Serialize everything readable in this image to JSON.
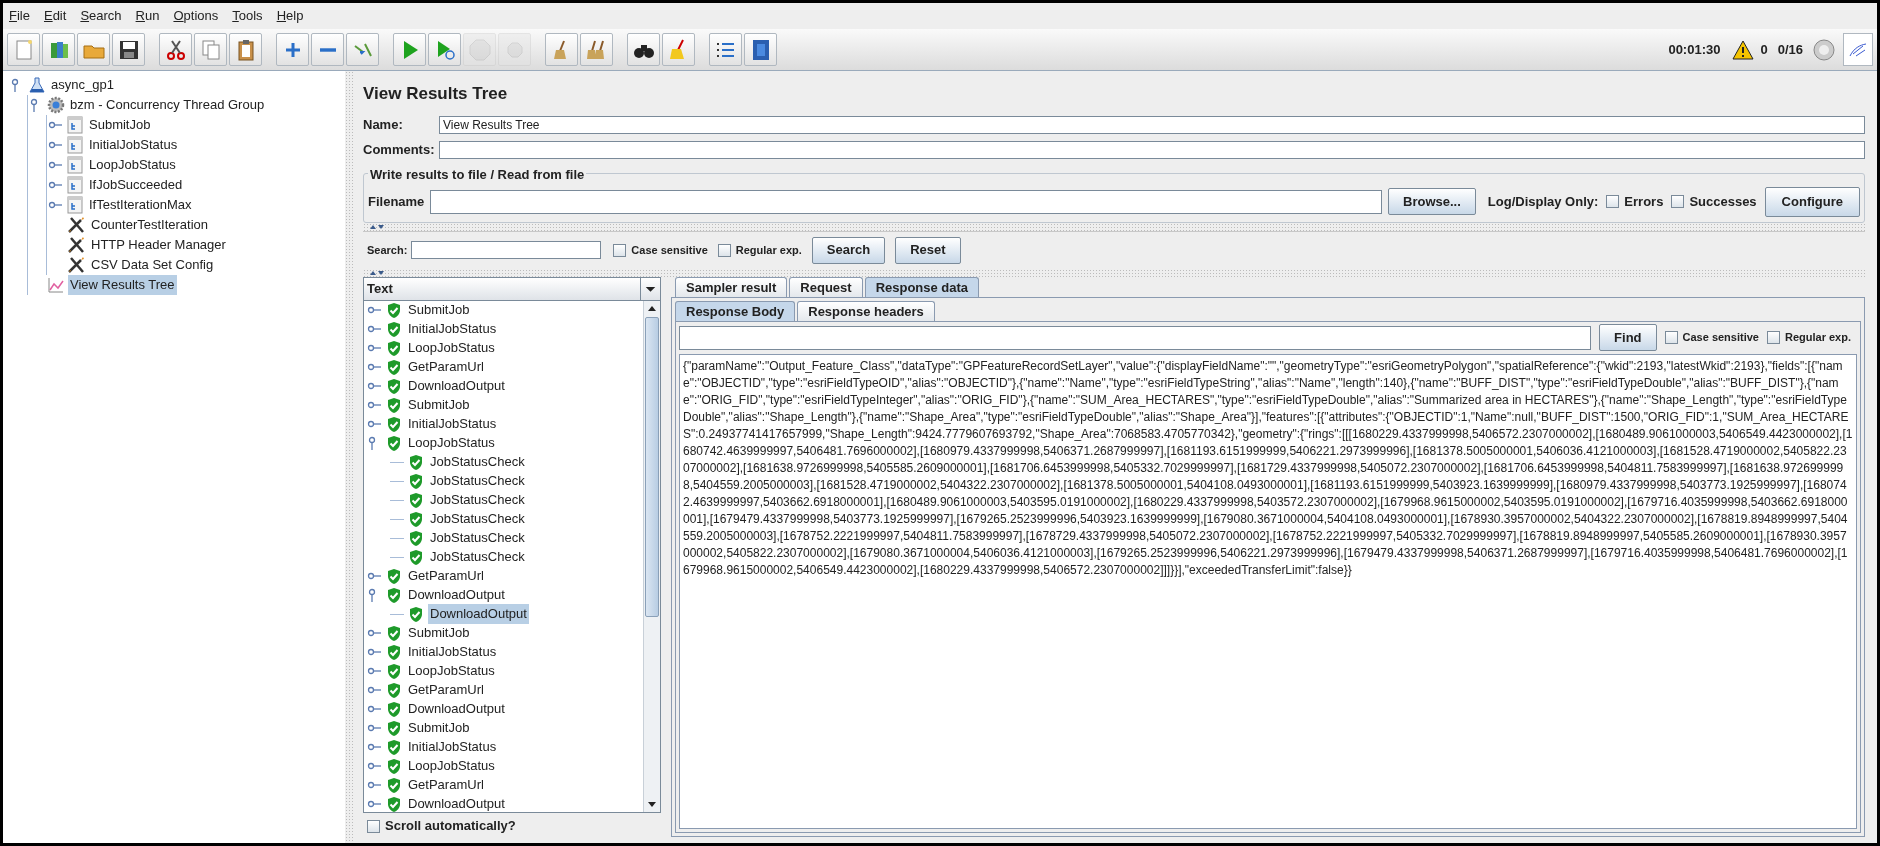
{
  "menu": [
    "File",
    "Edit",
    "Search",
    "Run",
    "Options",
    "Tools",
    "Help"
  ],
  "toolbar": [
    {
      "kind": "new",
      "disabled": false
    },
    {
      "kind": "templates",
      "disabled": false
    },
    {
      "kind": "open",
      "disabled": false
    },
    {
      "kind": "save",
      "disabled": false
    },
    {
      "kind": "separator"
    },
    {
      "kind": "cut",
      "disabled": false
    },
    {
      "kind": "copy",
      "disabled": false
    },
    {
      "kind": "paste",
      "disabled": false
    },
    {
      "kind": "separator"
    },
    {
      "kind": "expand",
      "disabled": false
    },
    {
      "kind": "collapse",
      "disabled": false
    },
    {
      "kind": "toggle",
      "disabled": false
    },
    {
      "kind": "separator"
    },
    {
      "kind": "start",
      "disabled": false
    },
    {
      "kind": "start_no_pauses",
      "disabled": false
    },
    {
      "kind": "stop",
      "disabled": true
    },
    {
      "kind": "shutdown",
      "disabled": true
    },
    {
      "kind": "separator"
    },
    {
      "kind": "clear",
      "disabled": false
    },
    {
      "kind": "clear_all",
      "disabled": false
    },
    {
      "kind": "separator"
    },
    {
      "kind": "search",
      "disabled": false
    },
    {
      "kind": "reset_search",
      "disabled": false
    },
    {
      "kind": "separator"
    },
    {
      "kind": "function_helper",
      "disabled": false
    },
    {
      "kind": "help",
      "disabled": false
    }
  ],
  "status": {
    "elapsed": "00:01:30",
    "warnings": "0",
    "threads": "0/16"
  },
  "test_plan": [
    {
      "label": "async_gp1",
      "kind": "plan",
      "expanded": true,
      "selected": false,
      "children": [
        {
          "label": "bzm - Concurrency Thread Group",
          "kind": "thread_group",
          "expanded": true,
          "selected": false,
          "children": [
            {
              "label": "SubmitJob",
              "kind": "controller",
              "expanded": false,
              "selected": false
            },
            {
              "label": "InitialJobStatus",
              "kind": "controller",
              "expanded": false,
              "selected": false
            },
            {
              "label": "LoopJobStatus",
              "kind": "controller",
              "expanded": false,
              "selected": false
            },
            {
              "label": "IfJobSucceeded",
              "kind": "controller",
              "expanded": false,
              "selected": false
            },
            {
              "label": "IfTestIterationMax",
              "kind": "controller",
              "expanded": false,
              "selected": false
            },
            {
              "label": "CounterTestIteration",
              "kind": "config",
              "selected": false
            },
            {
              "label": "HTTP Header Manager",
              "kind": "config",
              "selected": false
            },
            {
              "label": "CSV Data Set Config",
              "kind": "config",
              "selected": false
            }
          ]
        },
        {
          "label": "View Results Tree",
          "kind": "listener",
          "selected": true
        }
      ]
    }
  ],
  "panel": {
    "title": "View Results Tree",
    "name_label": "Name:",
    "name_value": "View Results Tree",
    "comments_label": "Comments:",
    "file_group": {
      "title": "Write results to file / Read from file",
      "filename_label": "Filename",
      "browse": "Browse...",
      "log_label": "Log/Display Only:",
      "errors": {
        "label": "Errors",
        "checked": false
      },
      "successes": {
        "label": "Successes",
        "checked": false
      },
      "configure": "Configure"
    },
    "search": {
      "label": "Search:",
      "case_sensitive": {
        "label": "Case sensitive",
        "checked": false
      },
      "regex": {
        "label": "Regular exp.",
        "checked": false
      },
      "search_button": "Search",
      "reset_button": "Reset"
    }
  },
  "results": {
    "header": "Text",
    "scroll_auto": {
      "label": "Scroll automatically?",
      "checked": false
    },
    "items": [
      {
        "label": "SubmitJob",
        "expanded": false,
        "selected": false
      },
      {
        "label": "InitialJobStatus",
        "expanded": false,
        "selected": false
      },
      {
        "label": "LoopJobStatus",
        "expanded": false,
        "selected": false
      },
      {
        "label": "GetParamUrl",
        "expanded": false,
        "selected": false
      },
      {
        "label": "DownloadOutput",
        "expanded": false,
        "selected": false
      },
      {
        "label": "SubmitJob",
        "expanded": false,
        "selected": false
      },
      {
        "label": "InitialJobStatus",
        "expanded": false,
        "selected": false
      },
      {
        "label": "LoopJobStatus",
        "expanded": true,
        "selected": false,
        "children": [
          {
            "label": "JobStatusCheck",
            "selected": false
          },
          {
            "label": "JobStatusCheck",
            "selected": false
          },
          {
            "label": "JobStatusCheck",
            "selected": false
          },
          {
            "label": "JobStatusCheck",
            "selected": false
          },
          {
            "label": "JobStatusCheck",
            "selected": false
          },
          {
            "label": "JobStatusCheck",
            "selected": false
          }
        ]
      },
      {
        "label": "GetParamUrl",
        "expanded": false,
        "selected": false
      },
      {
        "label": "DownloadOutput",
        "expanded": true,
        "selected": false,
        "children": [
          {
            "label": "DownloadOutput",
            "selected": true
          }
        ]
      },
      {
        "label": "SubmitJob",
        "expanded": false,
        "selected": false
      },
      {
        "label": "InitialJobStatus",
        "expanded": false,
        "selected": false
      },
      {
        "label": "LoopJobStatus",
        "expanded": false,
        "selected": false
      },
      {
        "label": "GetParamUrl",
        "expanded": false,
        "selected": false
      },
      {
        "label": "DownloadOutput",
        "expanded": false,
        "selected": false
      },
      {
        "label": "SubmitJob",
        "expanded": false,
        "selected": false
      },
      {
        "label": "InitialJobStatus",
        "expanded": false,
        "selected": false
      },
      {
        "label": "LoopJobStatus",
        "expanded": false,
        "selected": false
      },
      {
        "label": "GetParamUrl",
        "expanded": false,
        "selected": false
      },
      {
        "label": "DownloadOutput",
        "expanded": false,
        "selected": false
      }
    ]
  },
  "detail": {
    "tabs": [
      {
        "label": "Sampler result",
        "selected": false
      },
      {
        "label": "Request",
        "selected": false
      },
      {
        "label": "Response data",
        "selected": true
      }
    ],
    "subtabs": [
      {
        "label": "Response Body",
        "selected": true
      },
      {
        "label": "Response headers",
        "selected": false
      }
    ],
    "find_button": "Find",
    "case_sensitive": {
      "label": "Case sensitive",
      "checked": false
    },
    "regex": {
      "label": "Regular exp.",
      "checked": false
    },
    "response_text": "{\"paramName\":\"Output_Feature_Class\",\"dataType\":\"GPFeatureRecordSetLayer\",\"value\":{\"displayFieldName\":\"\",\"geometryType\":\"esriGeometryPolygon\",\"spatialReference\":{\"wkid\":2193,\"latestWkid\":2193},\"fields\":[{\"name\":\"OBJECTID\",\"type\":\"esriFieldTypeOID\",\"alias\":\"OBJECTID\"},{\"name\":\"Name\",\"type\":\"esriFieldTypeString\",\"alias\":\"Name\",\"length\":140},{\"name\":\"BUFF_DIST\",\"type\":\"esriFieldTypeDouble\",\"alias\":\"BUFF_DIST\"},{\"name\":\"ORIG_FID\",\"type\":\"esriFieldTypeInteger\",\"alias\":\"ORIG_FID\"},{\"name\":\"SUM_Area_HECTARES\",\"type\":\"esriFieldTypeDouble\",\"alias\":\"Summarized area in HECTARES\"},{\"name\":\"Shape_Length\",\"type\":\"esriFieldTypeDouble\",\"alias\":\"Shape_Length\"},{\"name\":\"Shape_Area\",\"type\":\"esriFieldTypeDouble\",\"alias\":\"Shape_Area\"}],\"features\":[{\"attributes\":{\"OBJECTID\":1,\"Name\":null,\"BUFF_DIST\":1500,\"ORIG_FID\":1,\"SUM_Area_HECTARES\":0.24937741417657999,\"Shape_Length\":9424.7779607693792,\"Shape_Area\":7068583.4705770342},\"geometry\":{\"rings\":[[[1680229.4337999998,5406572.2307000002],[1680489.9061000003,5406549.4423000002],[1680742.4639999997,5406481.7696000002],[1680979.4337999998,5406371.2687999997],[1681193.6151999999,5406221.2973999996],[1681378.5005000001,5406036.4121000003],[1681528.4719000002,5405822.2307000002],[1681638.9726999998,5405585.2609000001],[1681706.6453999998,5405332.7029999997],[1681729.4337999998,5405072.2307000002],[1681706.6453999998,5404811.7583999997],[1681638.9726999998,5404559.2005000003],[1681528.4719000002,5404322.2307000002],[1681378.5005000001,5404108.0493000001],[1681193.6151999999,5403923.1639999999],[1680979.4337999998,5403773.1925999997],[1680742.4639999997,5403662.6918000001],[1680489.9061000003,5403595.0191000002],[1680229.4337999998,5403572.2307000002],[1679968.9615000002,5403595.0191000002],[1679716.4035999998,5403662.6918000001],[1679479.4337999998,5403773.1925999997],[1679265.2523999996,5403923.1639999999],[1679080.3671000004,5404108.0493000001],[1678930.3957000002,5404322.2307000002],[1678819.8948999997,5404559.2005000003],[1678752.2221999997,5404811.7583999997],[1678729.4337999998,5405072.2307000002],[1678752.2221999997,5405332.7029999997],[1678819.8948999997,5405585.2609000001],[1678930.3957000002,5405822.2307000002],[1679080.3671000004,5406036.4121000003],[1679265.2523999996,5406221.2973999996],[1679479.4337999998,5406371.2687999997],[1679716.4035999998,5406481.7696000002],[1679968.9615000002,5406549.4423000002],[1680229.4337999998,5406572.2307000002]]]}}],\"exceededTransferLimit\":false}}"
  }
}
